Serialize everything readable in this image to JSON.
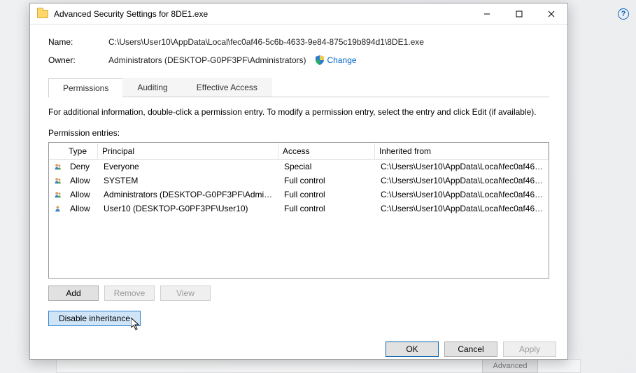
{
  "titlebar": {
    "title": "Advanced Security Settings for 8DE1.exe"
  },
  "fields": {
    "name_label": "Name:",
    "name_value": "C:\\Users\\User10\\AppData\\Local\\fec0af46-5c6b-4633-9e84-875c19b894d1\\8DE1.exe",
    "owner_label": "Owner:",
    "owner_value": "Administrators (DESKTOP-G0PF3PF\\Administrators)",
    "change_link": "Change"
  },
  "tabs": {
    "permissions": "Permissions",
    "auditing": "Auditing",
    "effective": "Effective Access"
  },
  "helptext": "For additional information, double-click a permission entry. To modify a permission entry, select the entry and click Edit (if available).",
  "entries_label": "Permission entries:",
  "grid": {
    "headers": {
      "type": "Type",
      "principal": "Principal",
      "access": "Access",
      "inherited": "Inherited from"
    },
    "rows": [
      {
        "type": "Deny",
        "principal": "Everyone",
        "access": "Special",
        "inherited": "C:\\Users\\User10\\AppData\\Local\\fec0af46-5..."
      },
      {
        "type": "Allow",
        "principal": "SYSTEM",
        "access": "Full control",
        "inherited": "C:\\Users\\User10\\AppData\\Local\\fec0af46-5..."
      },
      {
        "type": "Allow",
        "principal": "Administrators (DESKTOP-G0PF3PF\\Admini...",
        "access": "Full control",
        "inherited": "C:\\Users\\User10\\AppData\\Local\\fec0af46-5..."
      },
      {
        "type": "Allow",
        "principal": "User10 (DESKTOP-G0PF3PF\\User10)",
        "access": "Full control",
        "inherited": "C:\\Users\\User10\\AppData\\Local\\fec0af46-5..."
      }
    ]
  },
  "buttons": {
    "add": "Add",
    "remove": "Remove",
    "view": "View",
    "disable_inheritance": "Disable inheritance",
    "ok": "OK",
    "cancel": "Cancel",
    "apply": "Apply"
  },
  "background": {
    "advanced": "Advanced"
  }
}
